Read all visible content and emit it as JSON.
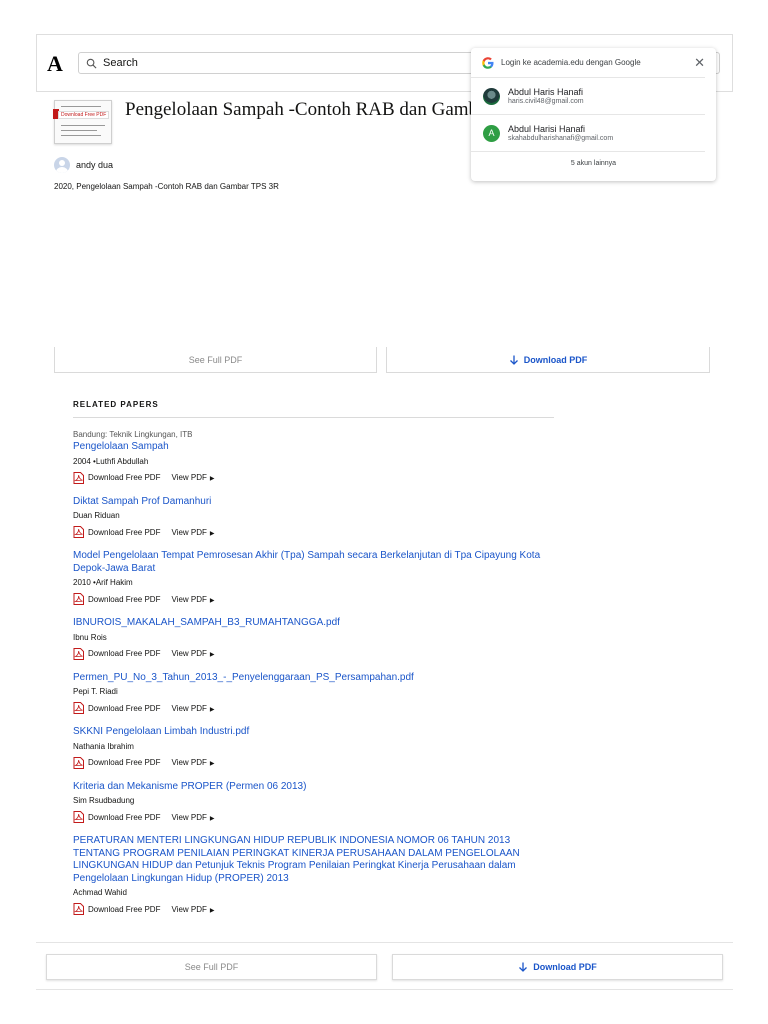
{
  "header": {
    "logo": "A",
    "search": {
      "placeholder": "Search",
      "value": "Search"
    }
  },
  "document": {
    "thumb_tag": "Download Free PDF",
    "title": "Pengelolaan Sampah -Contoh RAB dan Gambar TPS 3R",
    "author": "andy dua",
    "meta": "2020, Pengelolaan Sampah -Contoh RAB dan Gambar TPS 3R"
  },
  "buttons": {
    "see_full_pdf": "See Full PDF",
    "download_pdf": "Download PDF"
  },
  "related": {
    "heading": "RELATED PAPERS",
    "download_label": "Download Free PDF",
    "view_label": "View PDF",
    "papers": [
      {
        "pre": "Bandung: Teknik Lingkungan, ITB",
        "title": "Pengelolaan Sampah",
        "authors": "2004 •Luthfi Abdullah"
      },
      {
        "pre": "",
        "title": "Diktat Sampah Prof Damanhuri",
        "authors": "Duan Riduan"
      },
      {
        "pre": "",
        "title": "Model Pengelolaan Tempat Pemrosesan Akhir (Tpa) Sampah secara Berkelanjutan di Tpa Cipayung Kota Depok-Jawa Barat",
        "authors": "2010 •Arif Hakim"
      },
      {
        "pre": "",
        "title": "IBNUROIS_MAKALAH_SAMPAH_B3_RUMAHTANGGA.pdf",
        "authors": "Ibnu Rois"
      },
      {
        "pre": "",
        "title": "Permen_PU_No_3_Tahun_2013_-_Penyelenggaraan_PS_Persampahan.pdf",
        "authors": "Pepi T. Riadi"
      },
      {
        "pre": "",
        "title": "SKKNI Pengelolaan Limbah Industri.pdf",
        "authors": "Nathania Ibrahim"
      },
      {
        "pre": "",
        "title": "Kriteria dan Mekanisme PROPER (Permen 06 2013)",
        "authors": "Sim Rsudbadung"
      },
      {
        "pre": "",
        "title": "PERATURAN MENTERI LINGKUNGAN HIDUP REPUBLIK INDONESIA NOMOR 06 TAHUN 2013 TENTANG PROGRAM PENILAIAN PERINGKAT KINERJA PERUSAHAAN DALAM PENGELOLAAN LINGKUNGAN HIDUP dan Petunjuk Teknis Program Penilaian Peringkat Kinerja Perusahaan dalam Pengelolaan Lingkungan Hidup (PROPER) 2013",
        "authors": "Achmad Wahid"
      }
    ]
  },
  "google_popup": {
    "title": "Login ke academia.edu dengan Google",
    "accounts": [
      {
        "name": "Abdul Haris Hanafi",
        "email": "haris.civil48@gmail.com",
        "avatar": "photo"
      },
      {
        "name": "Abdul Harisi Hanafi",
        "email": "skahabdulharishanafi@gmail.com",
        "avatar": "A"
      }
    ],
    "more": "5 akun lainnya"
  },
  "colors": {
    "link": "#1a55c9",
    "pdf_red": "#c21a1a",
    "google_green": "#2f9e44"
  }
}
